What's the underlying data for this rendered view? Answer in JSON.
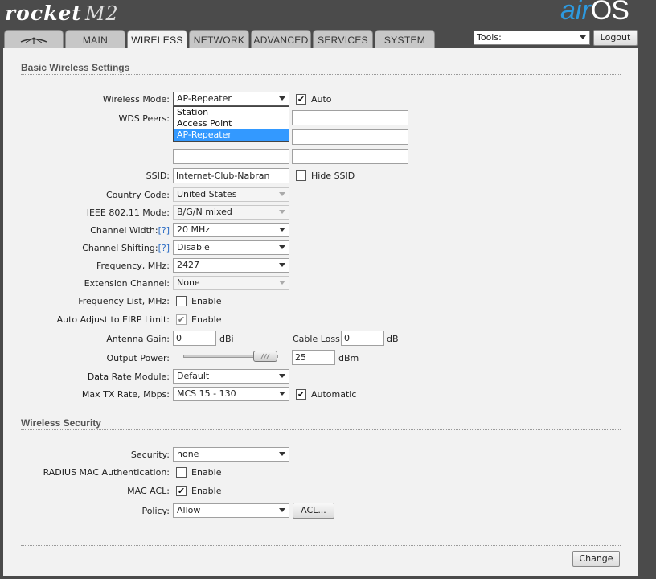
{
  "header": {
    "logo_left": "rocket",
    "logo_left_model": "M2",
    "logo_right_air": "air",
    "logo_right_os": "OS"
  },
  "tabs": [
    {
      "label": "MAIN"
    },
    {
      "label": "WIRELESS"
    },
    {
      "label": "NETWORK"
    },
    {
      "label": "ADVANCED"
    },
    {
      "label": "SERVICES"
    },
    {
      "label": "SYSTEM"
    }
  ],
  "tools": {
    "label": "Tools:"
  },
  "logout": {
    "label": "Logout"
  },
  "basic": {
    "title": "Basic Wireless Settings",
    "wireless_mode": {
      "label": "Wireless Mode:",
      "value": "AP-Repeater",
      "auto_label": "Auto",
      "auto_checked": true
    },
    "mode_options": [
      "Station",
      "Access Point",
      "AP-Repeater"
    ],
    "wds_peers": {
      "label": "WDS Peers:"
    },
    "ssid": {
      "label": "SSID:",
      "value": "Internet-Club-Nabran",
      "hide_label": "Hide SSID"
    },
    "country": {
      "label": "Country Code:",
      "value": "United States"
    },
    "ieee": {
      "label": "IEEE 802.11 Mode:",
      "value": "B/G/N mixed"
    },
    "channel_width": {
      "label": "Channel Width:",
      "help": "[?]",
      "value": "20 MHz"
    },
    "channel_shifting": {
      "label": "Channel Shifting:",
      "help": "[?]",
      "value": "Disable"
    },
    "frequency": {
      "label": "Frequency, MHz:",
      "value": "2427"
    },
    "extension": {
      "label": "Extension Channel:",
      "value": "None"
    },
    "freq_list": {
      "label": "Frequency List, MHz:",
      "enable": "Enable"
    },
    "eirp": {
      "label": "Auto Adjust to EIRP Limit:",
      "enable": "Enable"
    },
    "antenna_gain": {
      "label": "Antenna Gain:",
      "value": "0",
      "unit": "dBi"
    },
    "cable_loss": {
      "label": "Cable Loss:",
      "value": "0",
      "unit": "dB"
    },
    "output_power": {
      "label": "Output Power:",
      "value": "25",
      "unit": "dBm"
    },
    "data_rate": {
      "label": "Data Rate Module:",
      "value": "Default"
    },
    "max_tx": {
      "label": "Max TX Rate, Mbps:",
      "value": "MCS 15 - 130",
      "auto_label": "Automatic"
    }
  },
  "security": {
    "title": "Wireless Security",
    "security": {
      "label": "Security:",
      "value": "none"
    },
    "radius": {
      "label": "RADIUS MAC Authentication:",
      "enable": "Enable"
    },
    "mac_acl": {
      "label": "MAC ACL:",
      "enable": "Enable"
    },
    "policy": {
      "label": "Policy:",
      "value": "Allow",
      "acl_button": "ACL..."
    }
  },
  "change": {
    "label": "Change"
  },
  "check_mark": "✔"
}
